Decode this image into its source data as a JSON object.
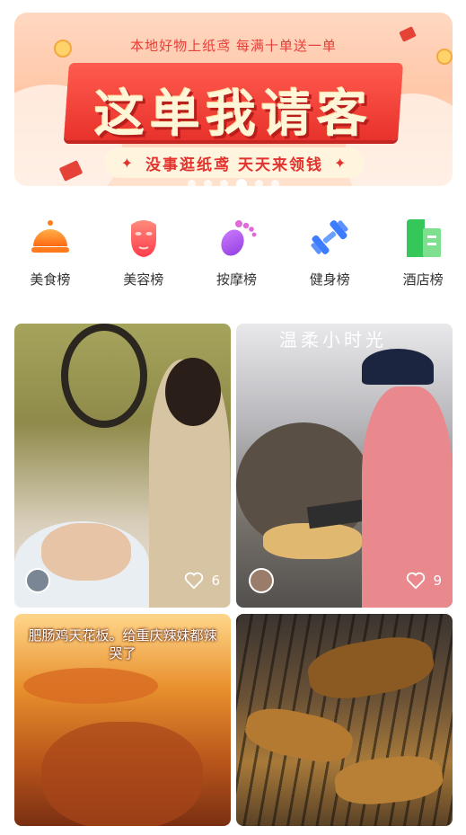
{
  "banner": {
    "top_text": "本地好物上纸鸢   每满十单送一单",
    "headline": "这单我请客",
    "pill_text": "没事逛纸鸢  天天来领钱",
    "slide_count": 6,
    "active_slide": 4
  },
  "categories": [
    {
      "label": "美食榜",
      "icon": "food-cloche-icon",
      "color": "#ff8a1f"
    },
    {
      "label": "美容榜",
      "icon": "face-mask-icon",
      "color": "#ff5a5a"
    },
    {
      "label": "按摩榜",
      "icon": "foot-icon",
      "color": "#b05cf0"
    },
    {
      "label": "健身榜",
      "icon": "dumbbell-icon",
      "color": "#3d7cff"
    },
    {
      "label": "酒店榜",
      "icon": "hotel-building-icon",
      "color": "#35c75a"
    }
  ],
  "feed": [
    {
      "likes": "6",
      "caption": ""
    },
    {
      "likes": "9",
      "caption": "",
      "watermark": "温柔小时光"
    },
    {
      "caption": "肥肠鸡天花板。给重庆辣妹都辣哭了"
    },
    {
      "caption": ""
    }
  ],
  "colors": {
    "accent_red": "#e4403a",
    "label_text": "#333333"
  }
}
